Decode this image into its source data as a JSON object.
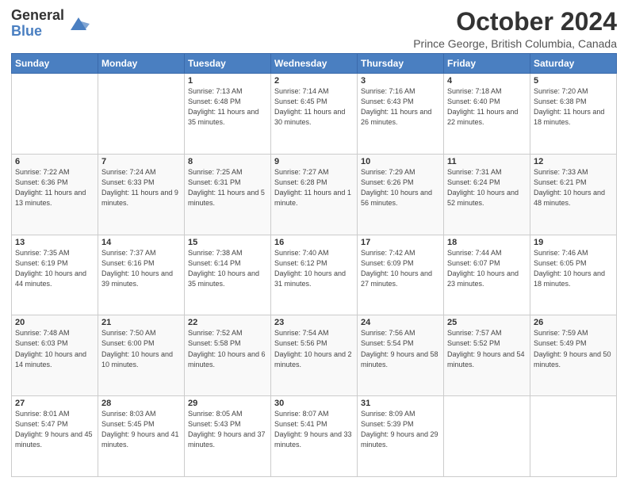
{
  "header": {
    "logo_line1": "General",
    "logo_line2": "Blue",
    "title": "October 2024",
    "location": "Prince George, British Columbia, Canada"
  },
  "days_of_week": [
    "Sunday",
    "Monday",
    "Tuesday",
    "Wednesday",
    "Thursday",
    "Friday",
    "Saturday"
  ],
  "weeks": [
    [
      {
        "day": "",
        "sunrise": "",
        "sunset": "",
        "daylight": ""
      },
      {
        "day": "",
        "sunrise": "",
        "sunset": "",
        "daylight": ""
      },
      {
        "day": "1",
        "sunrise": "Sunrise: 7:13 AM",
        "sunset": "Sunset: 6:48 PM",
        "daylight": "Daylight: 11 hours and 35 minutes."
      },
      {
        "day": "2",
        "sunrise": "Sunrise: 7:14 AM",
        "sunset": "Sunset: 6:45 PM",
        "daylight": "Daylight: 11 hours and 30 minutes."
      },
      {
        "day": "3",
        "sunrise": "Sunrise: 7:16 AM",
        "sunset": "Sunset: 6:43 PM",
        "daylight": "Daylight: 11 hours and 26 minutes."
      },
      {
        "day": "4",
        "sunrise": "Sunrise: 7:18 AM",
        "sunset": "Sunset: 6:40 PM",
        "daylight": "Daylight: 11 hours and 22 minutes."
      },
      {
        "day": "5",
        "sunrise": "Sunrise: 7:20 AM",
        "sunset": "Sunset: 6:38 PM",
        "daylight": "Daylight: 11 hours and 18 minutes."
      }
    ],
    [
      {
        "day": "6",
        "sunrise": "Sunrise: 7:22 AM",
        "sunset": "Sunset: 6:36 PM",
        "daylight": "Daylight: 11 hours and 13 minutes."
      },
      {
        "day": "7",
        "sunrise": "Sunrise: 7:24 AM",
        "sunset": "Sunset: 6:33 PM",
        "daylight": "Daylight: 11 hours and 9 minutes."
      },
      {
        "day": "8",
        "sunrise": "Sunrise: 7:25 AM",
        "sunset": "Sunset: 6:31 PM",
        "daylight": "Daylight: 11 hours and 5 minutes."
      },
      {
        "day": "9",
        "sunrise": "Sunrise: 7:27 AM",
        "sunset": "Sunset: 6:28 PM",
        "daylight": "Daylight: 11 hours and 1 minute."
      },
      {
        "day": "10",
        "sunrise": "Sunrise: 7:29 AM",
        "sunset": "Sunset: 6:26 PM",
        "daylight": "Daylight: 10 hours and 56 minutes."
      },
      {
        "day": "11",
        "sunrise": "Sunrise: 7:31 AM",
        "sunset": "Sunset: 6:24 PM",
        "daylight": "Daylight: 10 hours and 52 minutes."
      },
      {
        "day": "12",
        "sunrise": "Sunrise: 7:33 AM",
        "sunset": "Sunset: 6:21 PM",
        "daylight": "Daylight: 10 hours and 48 minutes."
      }
    ],
    [
      {
        "day": "13",
        "sunrise": "Sunrise: 7:35 AM",
        "sunset": "Sunset: 6:19 PM",
        "daylight": "Daylight: 10 hours and 44 minutes."
      },
      {
        "day": "14",
        "sunrise": "Sunrise: 7:37 AM",
        "sunset": "Sunset: 6:16 PM",
        "daylight": "Daylight: 10 hours and 39 minutes."
      },
      {
        "day": "15",
        "sunrise": "Sunrise: 7:38 AM",
        "sunset": "Sunset: 6:14 PM",
        "daylight": "Daylight: 10 hours and 35 minutes."
      },
      {
        "day": "16",
        "sunrise": "Sunrise: 7:40 AM",
        "sunset": "Sunset: 6:12 PM",
        "daylight": "Daylight: 10 hours and 31 minutes."
      },
      {
        "day": "17",
        "sunrise": "Sunrise: 7:42 AM",
        "sunset": "Sunset: 6:09 PM",
        "daylight": "Daylight: 10 hours and 27 minutes."
      },
      {
        "day": "18",
        "sunrise": "Sunrise: 7:44 AM",
        "sunset": "Sunset: 6:07 PM",
        "daylight": "Daylight: 10 hours and 23 minutes."
      },
      {
        "day": "19",
        "sunrise": "Sunrise: 7:46 AM",
        "sunset": "Sunset: 6:05 PM",
        "daylight": "Daylight: 10 hours and 18 minutes."
      }
    ],
    [
      {
        "day": "20",
        "sunrise": "Sunrise: 7:48 AM",
        "sunset": "Sunset: 6:03 PM",
        "daylight": "Daylight: 10 hours and 14 minutes."
      },
      {
        "day": "21",
        "sunrise": "Sunrise: 7:50 AM",
        "sunset": "Sunset: 6:00 PM",
        "daylight": "Daylight: 10 hours and 10 minutes."
      },
      {
        "day": "22",
        "sunrise": "Sunrise: 7:52 AM",
        "sunset": "Sunset: 5:58 PM",
        "daylight": "Daylight: 10 hours and 6 minutes."
      },
      {
        "day": "23",
        "sunrise": "Sunrise: 7:54 AM",
        "sunset": "Sunset: 5:56 PM",
        "daylight": "Daylight: 10 hours and 2 minutes."
      },
      {
        "day": "24",
        "sunrise": "Sunrise: 7:56 AM",
        "sunset": "Sunset: 5:54 PM",
        "daylight": "Daylight: 9 hours and 58 minutes."
      },
      {
        "day": "25",
        "sunrise": "Sunrise: 7:57 AM",
        "sunset": "Sunset: 5:52 PM",
        "daylight": "Daylight: 9 hours and 54 minutes."
      },
      {
        "day": "26",
        "sunrise": "Sunrise: 7:59 AM",
        "sunset": "Sunset: 5:49 PM",
        "daylight": "Daylight: 9 hours and 50 minutes."
      }
    ],
    [
      {
        "day": "27",
        "sunrise": "Sunrise: 8:01 AM",
        "sunset": "Sunset: 5:47 PM",
        "daylight": "Daylight: 9 hours and 45 minutes."
      },
      {
        "day": "28",
        "sunrise": "Sunrise: 8:03 AM",
        "sunset": "Sunset: 5:45 PM",
        "daylight": "Daylight: 9 hours and 41 minutes."
      },
      {
        "day": "29",
        "sunrise": "Sunrise: 8:05 AM",
        "sunset": "Sunset: 5:43 PM",
        "daylight": "Daylight: 9 hours and 37 minutes."
      },
      {
        "day": "30",
        "sunrise": "Sunrise: 8:07 AM",
        "sunset": "Sunset: 5:41 PM",
        "daylight": "Daylight: 9 hours and 33 minutes."
      },
      {
        "day": "31",
        "sunrise": "Sunrise: 8:09 AM",
        "sunset": "Sunset: 5:39 PM",
        "daylight": "Daylight: 9 hours and 29 minutes."
      },
      {
        "day": "",
        "sunrise": "",
        "sunset": "",
        "daylight": ""
      },
      {
        "day": "",
        "sunrise": "",
        "sunset": "",
        "daylight": ""
      }
    ]
  ]
}
